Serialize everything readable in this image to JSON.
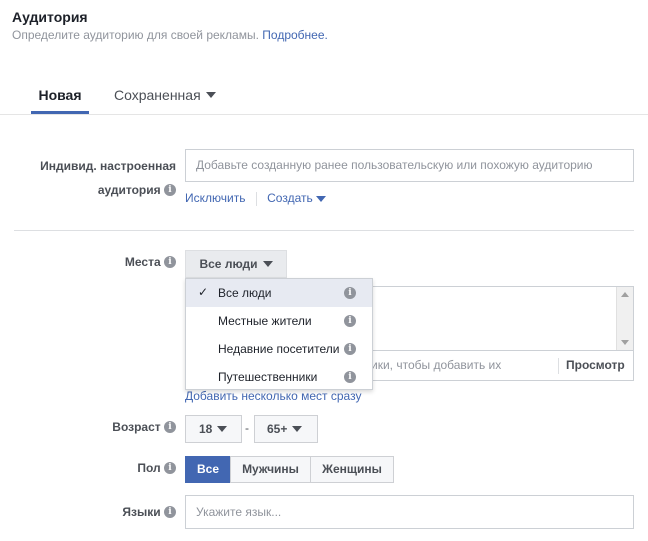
{
  "header": {
    "title": "Аудитория",
    "subtitle": "Определите аудиторию для своей рекламы.",
    "more_link": "Подробнее."
  },
  "tabs": [
    {
      "label": "Новая",
      "active": true
    },
    {
      "label": "Сохраненная",
      "active": false
    }
  ],
  "custom_audience": {
    "label_line1": "Индивид. настроенная",
    "label_line2": "аудитория",
    "placeholder": "Добавьте созданную ранее пользовательскую или похожую аудиторию",
    "exclude_link": "Исключить",
    "create_link": "Создать"
  },
  "locations": {
    "label": "Места",
    "selector_value": "Все люди",
    "search_placeholder_partial": "ики, чтобы добавить их",
    "browse_label": "Просмотр",
    "add_multiple_link": "Добавить несколько мест сразу",
    "options": [
      {
        "label": "Все люди",
        "selected": true
      },
      {
        "label": "Местные жители",
        "selected": false
      },
      {
        "label": "Недавние посетители",
        "selected": false
      },
      {
        "label": "Путешественники",
        "selected": false
      }
    ]
  },
  "age": {
    "label": "Возраст",
    "min": "18",
    "max": "65+",
    "separator": "-"
  },
  "gender": {
    "label": "Пол",
    "options": [
      {
        "label": "Все",
        "active": true
      },
      {
        "label": "Мужчины",
        "active": false
      },
      {
        "label": "Женщины",
        "active": false
      }
    ]
  },
  "languages": {
    "label": "Языки",
    "placeholder": "Укажите язык..."
  },
  "colors": {
    "accent": "#4267b2",
    "text": "#1d2129",
    "muted": "#90949c"
  }
}
